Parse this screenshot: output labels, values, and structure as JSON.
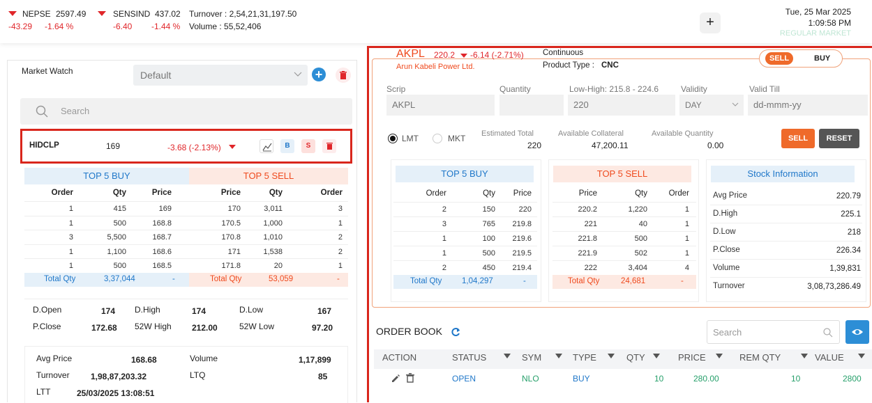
{
  "ticker": {
    "nepse": {
      "name": "NEPSE",
      "value": "2597.49",
      "change": "-43.29",
      "pct": "-1.64 %"
    },
    "sensind": {
      "name": "SENSIND",
      "value": "437.02",
      "change": "-6.40",
      "pct": "-1.44 %"
    },
    "turnover": "Turnover : 2,54,21,31,197.50",
    "volume": "Volume : 55,52,406"
  },
  "header_right": {
    "plus": "+",
    "date": "Tue, 25 Mar 2025",
    "time": "1:09:58 PM",
    "market": "REGULAR MARKET"
  },
  "market_watch": {
    "title": "Market Watch",
    "select_value": "Default",
    "search_placeholder": "Search",
    "row": {
      "symbol": "HIDCLP",
      "ltp": "169",
      "change": "-3.68 (-2.13%)",
      "b": "B",
      "s": "S"
    },
    "top5_buy_title": "TOP 5 BUY",
    "top5_sell_title": "TOP 5 SELL",
    "buy_headers": [
      "Order",
      "Qty",
      "Price"
    ],
    "sell_headers": [
      "Price",
      "Qty",
      "Order"
    ],
    "buy_rows": [
      [
        "1",
        "415",
        "169"
      ],
      [
        "1",
        "500",
        "168.8"
      ],
      [
        "3",
        "5,500",
        "168.7"
      ],
      [
        "1",
        "1,100",
        "168.6"
      ],
      [
        "1",
        "500",
        "168.5"
      ]
    ],
    "sell_rows": [
      [
        "170",
        "3,011",
        "3"
      ],
      [
        "170.5",
        "1,000",
        "1"
      ],
      [
        "170.8",
        "1,010",
        "2"
      ],
      [
        "171",
        "1,538",
        "2"
      ],
      [
        "171.8",
        "20",
        "1"
      ]
    ],
    "total_buy": {
      "label": "Total Qty",
      "value": "3,37,044",
      "dash": "-"
    },
    "total_sell": {
      "label": "Total Qty",
      "value": "53,059",
      "dash": "-"
    },
    "stats1": {
      "dopen_l": "D.Open",
      "dopen": "174",
      "dhigh_l": "D.High",
      "dhigh": "174",
      "dlow_l": "D.Low",
      "dlow": "167"
    },
    "stats2": {
      "pclose_l": "P.Close",
      "pclose": "172.68",
      "h52_l": "52W High",
      "h52": "212.00",
      "l52_l": "52W Low",
      "l52": "97.20"
    },
    "info": {
      "avg_l": "Avg Price",
      "avg": "168.68",
      "vol_l": "Volume",
      "vol": "1,17,899",
      "turn_l": "Turnover",
      "turn": "1,98,87,203.32",
      "ltq_l": "LTQ",
      "ltq": "85",
      "ltt_l": "LTT",
      "ltt": "25/03/2025 13:08:51"
    }
  },
  "order": {
    "symbol": "AKPL",
    "price": "220.2",
    "change": "-6.14 (-2.71%)",
    "company": "Arun Kabeli Power Ltd.",
    "continuous": "Continuous",
    "product_type_label": "Product Type :",
    "product_type": "CNC",
    "toggle_sell": "SELL",
    "toggle_buy": "BUY",
    "labels": {
      "scrip": "Scrip",
      "quantity": "Quantity",
      "lowhigh": "Low-High: 215.8 - 224.6",
      "validity": "Validity",
      "valid_till": "Valid Till"
    },
    "scrip_value": "AKPL",
    "price_value": "220",
    "validity_value": "DAY",
    "valid_till_placeholder": "dd-mmm-yy",
    "lmt": "LMT",
    "mkt": "MKT",
    "est_total_l": "Estimated Total",
    "est_total": "220",
    "collateral_l": "Available Collateral",
    "collateral": "47,200.11",
    "avail_qty_l": "Available Quantity",
    "avail_qty": "0.00",
    "sell_btn": "SELL",
    "reset_btn": "RESET",
    "top5_buy_title": "TOP 5 BUY",
    "top5_sell_title": "TOP 5 SELL",
    "stock_info_title": "Stock Information",
    "buy_headers": [
      "Order",
      "Qty",
      "Price"
    ],
    "sell_headers": [
      "Price",
      "Qty",
      "Order"
    ],
    "buy_rows": [
      [
        "2",
        "150",
        "220"
      ],
      [
        "3",
        "765",
        "219.8"
      ],
      [
        "1",
        "100",
        "219.6"
      ],
      [
        "1",
        "500",
        "219.5"
      ],
      [
        "2",
        "450",
        "219.4"
      ]
    ],
    "sell_rows": [
      [
        "220.2",
        "1,220",
        "1"
      ],
      [
        "221",
        "40",
        "1"
      ],
      [
        "221.8",
        "500",
        "1"
      ],
      [
        "221.9",
        "502",
        "1"
      ],
      [
        "222",
        "3,404",
        "4"
      ]
    ],
    "total_buy": {
      "label": "Total Qty",
      "value": "1,04,297",
      "dash": "-"
    },
    "total_sell": {
      "label": "Total Qty",
      "value": "24,681",
      "dash": "-"
    },
    "stock_info": [
      [
        "Avg Price",
        "220.79"
      ],
      [
        "D.High",
        "225.1"
      ],
      [
        "D.Low",
        "218"
      ],
      [
        "P.Close",
        "226.34"
      ],
      [
        "Volume",
        "1,39,831"
      ],
      [
        "Turnover",
        "3,08,73,286.49"
      ]
    ]
  },
  "order_book": {
    "title": "ORDER BOOK",
    "search_placeholder": "Search",
    "headers": [
      "ACTION",
      "STATUS",
      "SYM",
      "TYPE",
      "QTY",
      "PRICE",
      "REM QTY",
      "VALUE"
    ],
    "row": {
      "status": "OPEN",
      "sym": "NLO",
      "type": "BUY",
      "qty": "10",
      "price": "280.00",
      "rem": "10",
      "value": "2800"
    }
  }
}
